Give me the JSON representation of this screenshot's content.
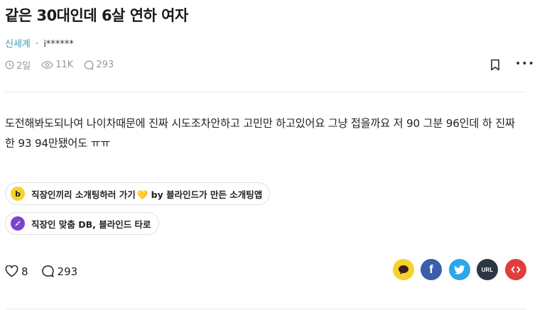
{
  "post": {
    "title": "같은 30대인데 6살 연하 여자",
    "channel": "신세계",
    "separator": "·",
    "author": "i******",
    "time": "2일",
    "views": "11K",
    "comments": "293",
    "body": "도전해봐도되나여 나이차때문에 진짜 시도조차안하고 고민만 하고있어요 그냥 접을까요 저 90 그분 96인데 하 진짜 한 93 94만됐어도 ㅠㅠ"
  },
  "promos": [
    {
      "label": "직장인끼리 소개팅하러 가기",
      "heart": "💛",
      "suffix": " by 블라인드가 만든 소개팅앱",
      "badge": "b",
      "badge_bg": "#f7d22b",
      "badge_color": "#222222",
      "icon": "blind-date-app-icon"
    },
    {
      "label": "직장인 맞춤 DB, 블라인드 타로",
      "heart": "",
      "suffix": "",
      "badge": "",
      "badge_bg": "#7a45c9",
      "badge_color": "#ffffff",
      "icon": "tarot-compass-icon"
    }
  ],
  "actions": {
    "likes": "8",
    "comments": "293"
  },
  "share": {
    "kakao_color": "#f7d22b",
    "facebook_color": "#3b5dab",
    "twitter_color": "#2ca6e8",
    "url_label": "URL",
    "url_color": "#2e3644",
    "embed_color": "#e23d3d"
  },
  "colors": {
    "accent": "#33a3b8",
    "muted": "#9a9a9a"
  }
}
